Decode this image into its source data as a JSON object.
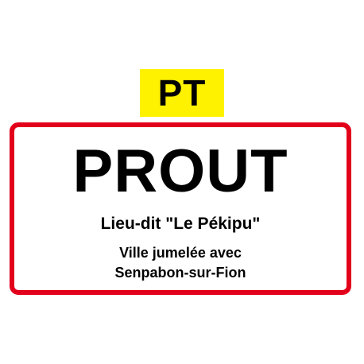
{
  "badge": {
    "label": "PT",
    "background_color": "#fff200",
    "text_color": "#000000"
  },
  "sign": {
    "title": "PROUT",
    "subtitle": "Lieu-dit \"Le Pékipu\"",
    "twinning_line1": "Ville jumelée avec",
    "twinning_line2": "Senpabon-sur-Fion",
    "border_color": "#e2001a",
    "background_color": "#ffffff",
    "text_color": "#000000"
  }
}
